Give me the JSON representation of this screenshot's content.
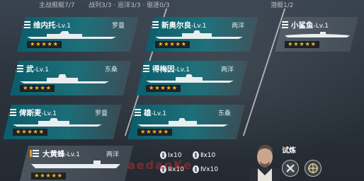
{
  "header": {
    "main_fleet": "主战舰艇7/7",
    "fleet_breakdown": "战列3/3 · 巡洋3/3 · 驱逐0/3",
    "submarine": "潜艇1/2"
  },
  "ships": [
    {
      "name": "维内托",
      "level": "-Lv.1",
      "nation": "罗曼",
      "stars": "★★★★★"
    },
    {
      "name": "新奥尔良",
      "level": "-Lv.1",
      "nation": "两洋",
      "stars": "★★★★★"
    },
    {
      "name": "武",
      "level": "-Lv.1",
      "nation": "东桑",
      "stars": "★★★★★"
    },
    {
      "name": "得梅因",
      "level": "-Lv.1",
      "nation": "两洋",
      "stars": "★★★★★"
    },
    {
      "name": "俾斯麦",
      "level": "-Lv.1",
      "nation": "罗曼",
      "stars": "★★★★★"
    },
    {
      "name": "雄",
      "level": "-Lv.1",
      "nation": "东桑",
      "stars": "★★★★★"
    },
    {
      "name": "大黄蜂",
      "level": "-Lv.1",
      "nation": "两洋",
      "stars": "★★★★★"
    }
  ],
  "submarines": [
    {
      "name": "小鲨鱼",
      "level": "-Lv.1",
      "stars": "★★★★★"
    }
  ],
  "weapons": [
    {
      "label": "Ⅰx10"
    },
    {
      "label": "Ⅱx10"
    },
    {
      "label": "Ⅲx10"
    },
    {
      "label": "Ⅳx10"
    }
  ],
  "commander": {
    "label": "试炼"
  },
  "watermark": "aedanKe"
}
